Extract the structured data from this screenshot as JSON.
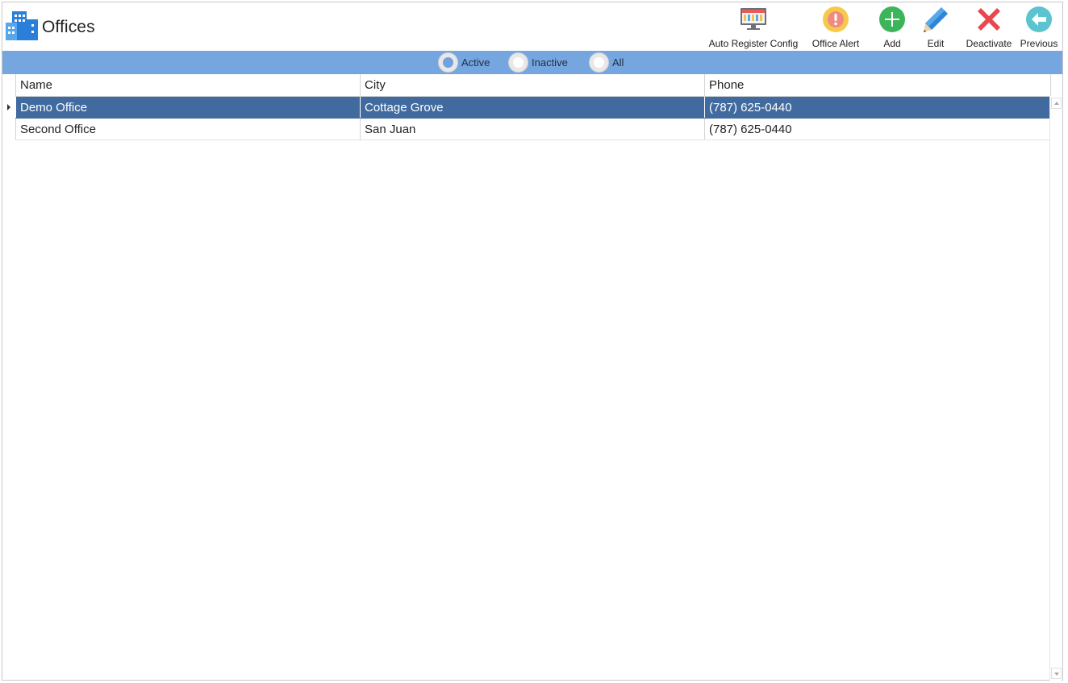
{
  "header": {
    "title": "Offices",
    "logo_icon": "office-buildings-icon"
  },
  "toolbar": {
    "buttons": [
      {
        "label": "Auto Register Config",
        "icon": "monitor-config-icon"
      },
      {
        "label": "Office Alert",
        "icon": "alert-icon"
      },
      {
        "label": "Add",
        "icon": "plus-circle-icon"
      },
      {
        "label": "Edit",
        "icon": "pencil-icon"
      },
      {
        "label": "Deactivate",
        "icon": "red-x-icon"
      },
      {
        "label": "Previous",
        "icon": "back-arrow-icon"
      }
    ]
  },
  "filter": {
    "options": [
      "Active",
      "Inactive",
      "All"
    ],
    "selected": "Active"
  },
  "grid": {
    "columns": [
      "Name",
      "City",
      "Phone"
    ],
    "rows": [
      {
        "name": "Demo Office",
        "city": "Cottage Grove",
        "phone": "(787) 625-0440",
        "selected": true
      },
      {
        "name": "Second Office",
        "city": "San Juan",
        "phone": "(787) 625-0440",
        "selected": false
      }
    ]
  },
  "colors": {
    "filter_bar": "#76a6e0",
    "selected_row": "#416b9f",
    "add_green": "#3cb45a",
    "deactivate_red": "#e8484d",
    "alert_yellow": "#f6c94a",
    "previous_teal": "#5cc4cf",
    "logo_blue": "#2a7fd8"
  }
}
